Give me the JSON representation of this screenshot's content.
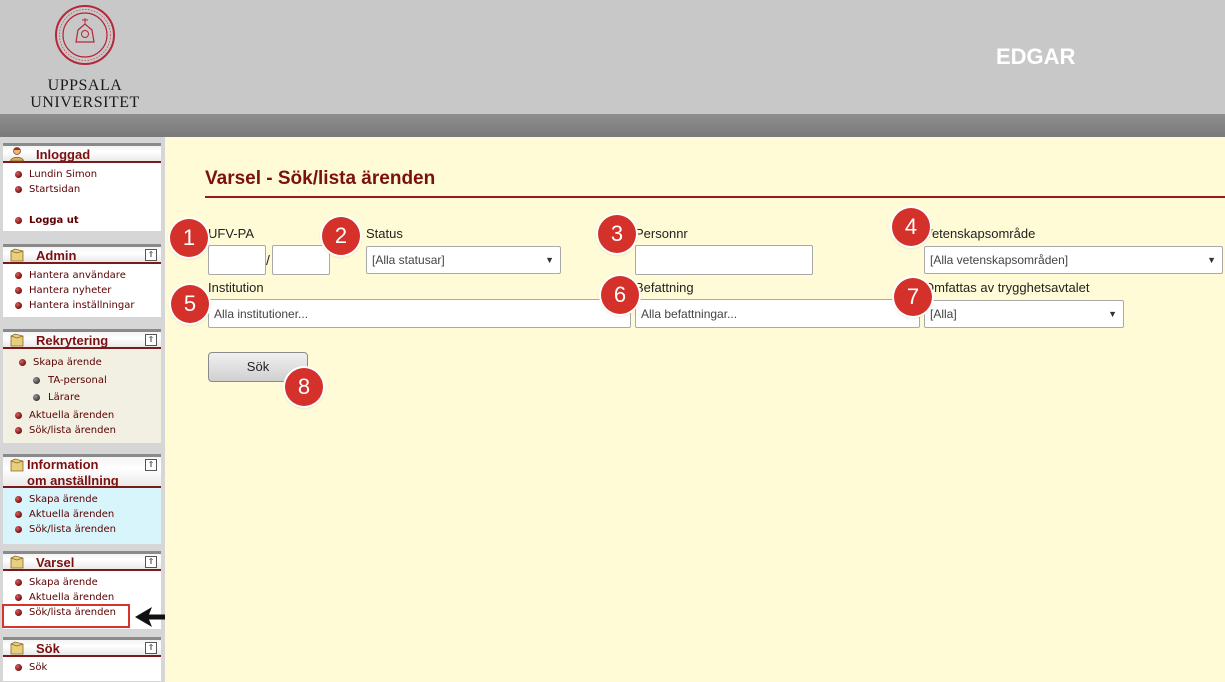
{
  "header": {
    "logo_line1": "UPPSALA",
    "logo_line2": "UNIVERSITET",
    "app_title": "EDGAR"
  },
  "sidebar": {
    "panels": [
      {
        "title": "Inloggad",
        "icon": "user-icon",
        "items": [
          {
            "label": "Lundin Simon"
          },
          {
            "label": "Startsidan"
          },
          {
            "label": "Logga ut"
          }
        ]
      },
      {
        "title": "Admin",
        "icon": "folder-icon",
        "items": [
          {
            "label": "Hantera användare"
          },
          {
            "label": "Hantera nyheter"
          },
          {
            "label": "Hantera inställningar"
          }
        ]
      },
      {
        "title": "Rekrytering",
        "icon": "folder-icon",
        "items": [
          {
            "label": "Skapa ärende"
          },
          {
            "label": "TA-personal"
          },
          {
            "label": "Lärare"
          },
          {
            "label": "Aktuella ärenden"
          },
          {
            "label": "Sök/lista ärenden"
          }
        ]
      },
      {
        "title_line1": "Information",
        "title_line2": "om anställning",
        "icon": "folder-icon",
        "items": [
          {
            "label": "Skapa ärende"
          },
          {
            "label": "Aktuella ärenden"
          },
          {
            "label": "Sök/lista ärenden"
          }
        ]
      },
      {
        "title": "Varsel",
        "icon": "folder-icon",
        "items": [
          {
            "label": "Skapa ärende"
          },
          {
            "label": "Aktuella ärenden"
          },
          {
            "label": "Sök/lista ärenden"
          }
        ]
      },
      {
        "title": "Sök",
        "icon": "folder-icon",
        "items": [
          {
            "label": "Sök"
          }
        ]
      }
    ],
    "collapse_glyph": "⇑"
  },
  "main": {
    "page_title": "Varsel - Sök/lista ärenden",
    "fields": {
      "ufv_label": "UFV-PA",
      "ufv_separator": "/",
      "ufv_part1": "",
      "ufv_part2": "",
      "status_label": "Status",
      "status_value": "[Alla statusar]",
      "personnr_label": "Personnr",
      "personnr_value": "",
      "vetenskap_label": "Vetenskapsområde",
      "vetenskap_value": "[Alla vetenskapsområden]",
      "institution_label": "Institution",
      "institution_placeholder": "Alla institutioner...",
      "befattning_label": "Befattning",
      "befattning_placeholder": "Alla befattningar...",
      "trygghet_label": "Omfattas av trygghetsavtalet",
      "trygghet_value": "[Alla]"
    },
    "search_button": "Sök"
  },
  "badges": [
    "1",
    "2",
    "3",
    "4",
    "5",
    "6",
    "7",
    "8"
  ],
  "colors": {
    "accent": "#7a1010",
    "badge": "#d3312a",
    "main_bg": "#fffbd6",
    "header_bg": "#c8c8c8"
  }
}
